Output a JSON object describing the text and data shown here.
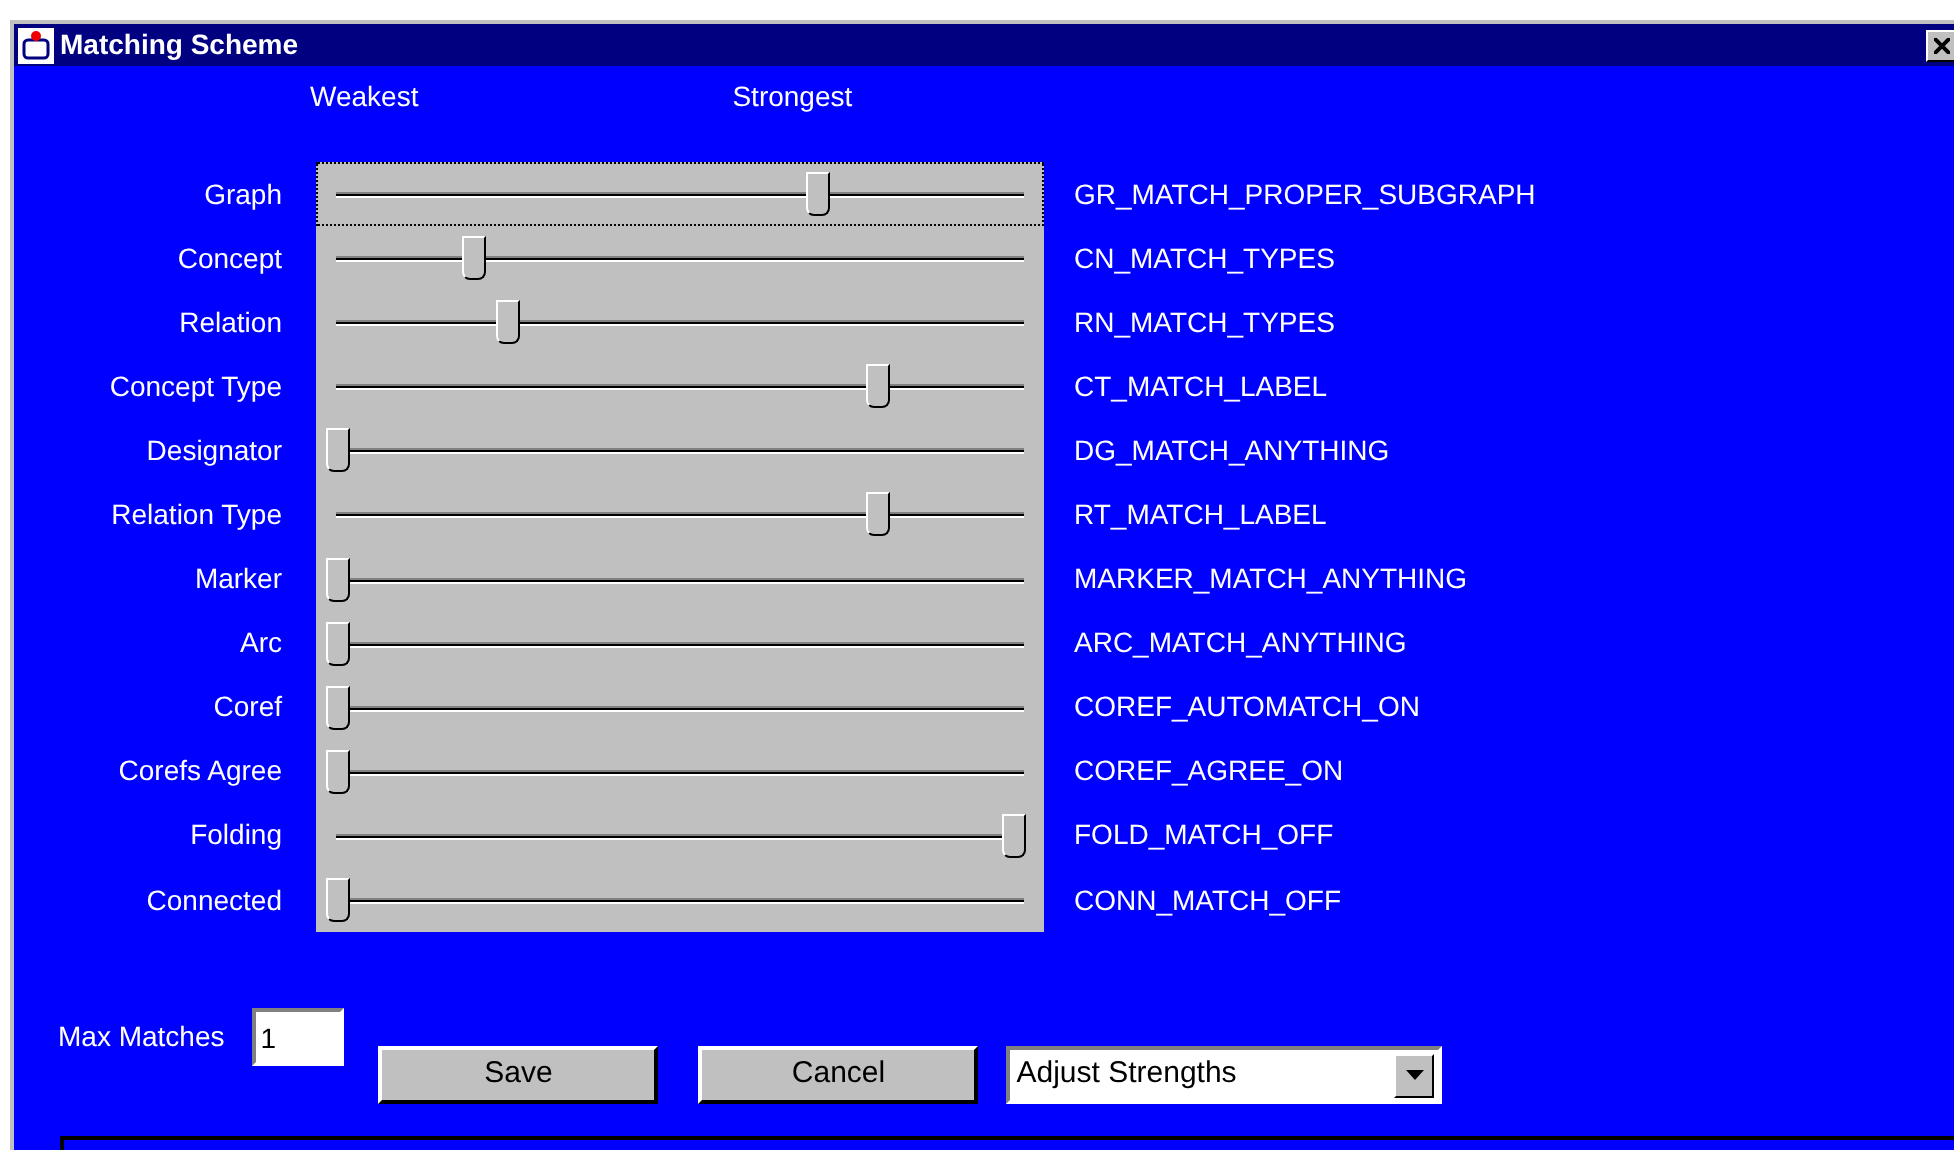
{
  "window": {
    "title": "Matching Scheme"
  },
  "scale": {
    "low": "Weakest",
    "high": "Strongest"
  },
  "sliders": [
    {
      "label": "Graph",
      "level": 0.71,
      "value": "GR_MATCH_PROPER_SUBGRAPH",
      "focused": true
    },
    {
      "label": "Concept",
      "level": 0.2,
      "value": "CN_MATCH_TYPES",
      "focused": false
    },
    {
      "label": "Relation",
      "level": 0.25,
      "value": "RN_MATCH_TYPES",
      "focused": false
    },
    {
      "label": "Concept Type",
      "level": 0.8,
      "value": "CT_MATCH_LABEL",
      "focused": false
    },
    {
      "label": "Designator",
      "level": 0,
      "value": "DG_MATCH_ANYTHING",
      "focused": false
    },
    {
      "label": "Relation Type",
      "level": 0.8,
      "value": "RT_MATCH_LABEL",
      "focused": false
    },
    {
      "label": "Marker",
      "level": 0,
      "value": "MARKER_MATCH_ANYTHING",
      "focused": false
    },
    {
      "label": "Arc",
      "level": 0,
      "value": "ARC_MATCH_ANYTHING",
      "focused": false
    },
    {
      "label": "Coref",
      "level": 0,
      "value": "COREF_AUTOMATCH_ON",
      "focused": false
    },
    {
      "label": "Corefs Agree",
      "level": 0,
      "value": "COREF_AGREE_ON",
      "focused": false
    },
    {
      "label": "Folding",
      "level": 1,
      "value": "FOLD_MATCH_OFF",
      "focused": false
    },
    {
      "label": "Connected",
      "level": 0,
      "value": "CONN_MATCH_OFF",
      "focused": false
    }
  ],
  "max_matches": {
    "label": "Max Matches",
    "value": "1"
  },
  "buttons": [
    "Save",
    "Cancel"
  ],
  "dropdown": {
    "value": "Adjust Strengths"
  }
}
